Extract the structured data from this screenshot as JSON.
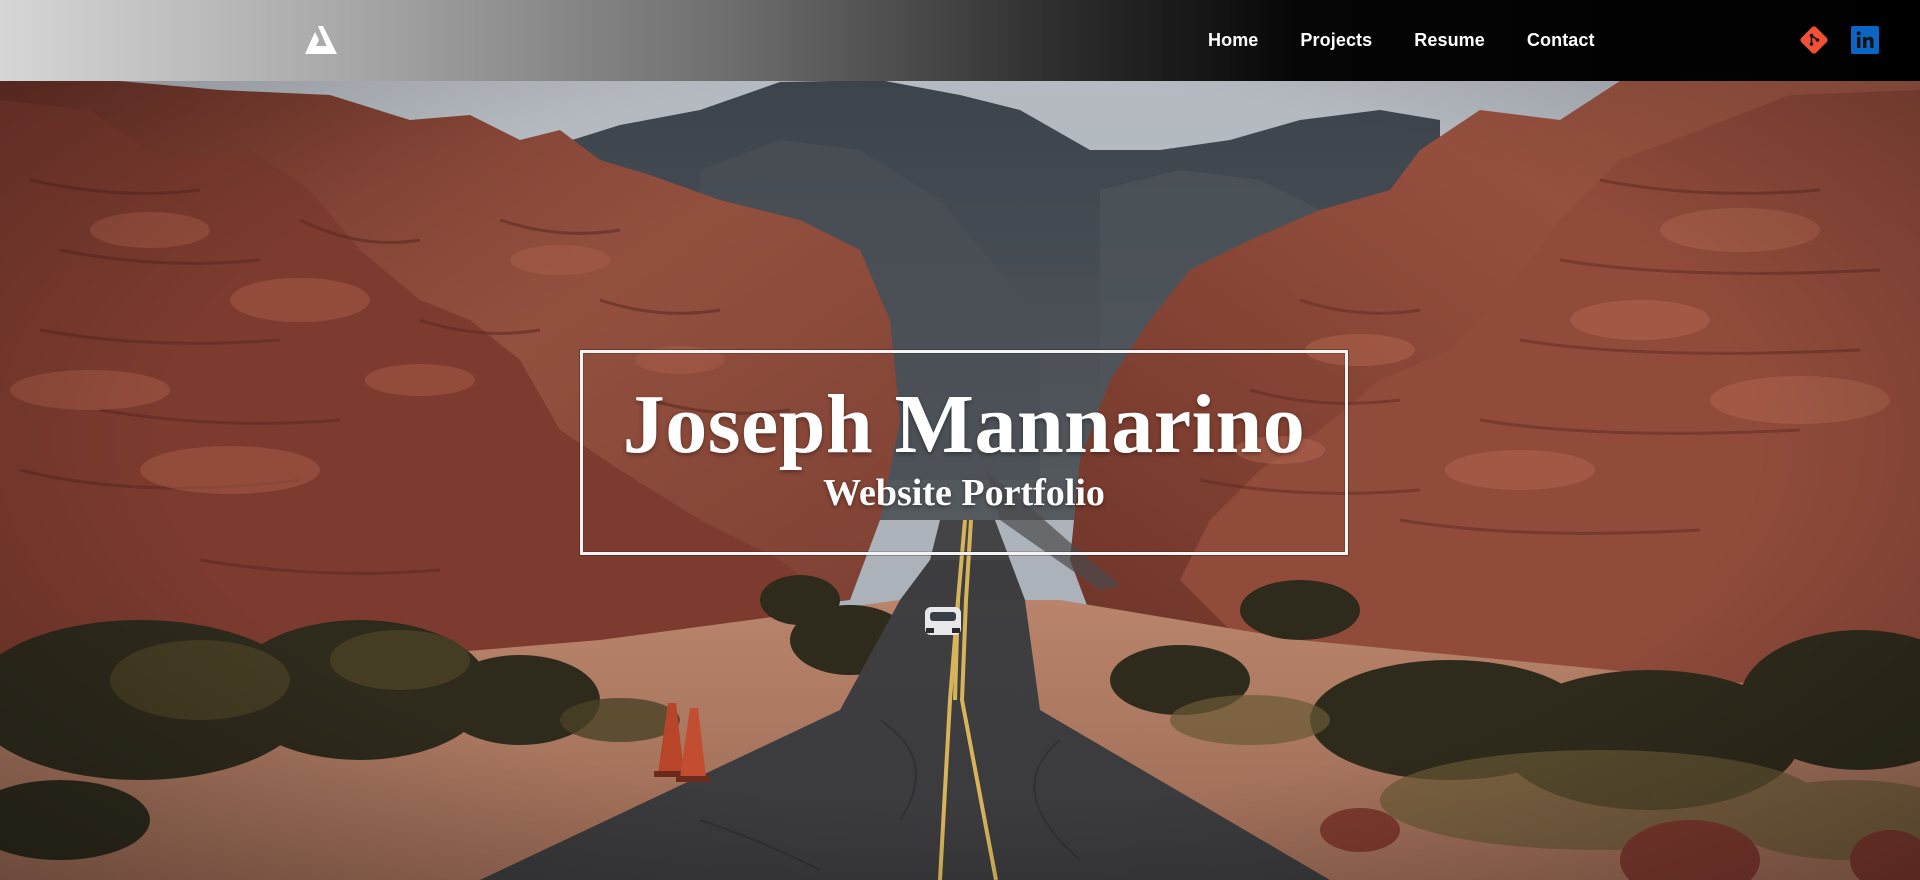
{
  "header": {
    "logo_icon": "triangle-a-logo-icon",
    "nav_links": [
      {
        "label": "Home"
      },
      {
        "label": "Projects"
      },
      {
        "label": "Resume"
      },
      {
        "label": "Contact"
      }
    ],
    "social": [
      {
        "name": "git-icon",
        "color": "#f05033"
      },
      {
        "name": "linkedin-icon",
        "color": "#0a66c2",
        "text": "in"
      }
    ]
  },
  "hero": {
    "name": "Joseph Mannarino",
    "subtitle": "Website Portfolio",
    "background": "desert-road-canyon-photo"
  },
  "colors": {
    "nav_gradient_start": "#d6d6d6",
    "nav_gradient_end": "#000000",
    "rock": "#8e4a3c",
    "sky": "#b9bdc2"
  }
}
